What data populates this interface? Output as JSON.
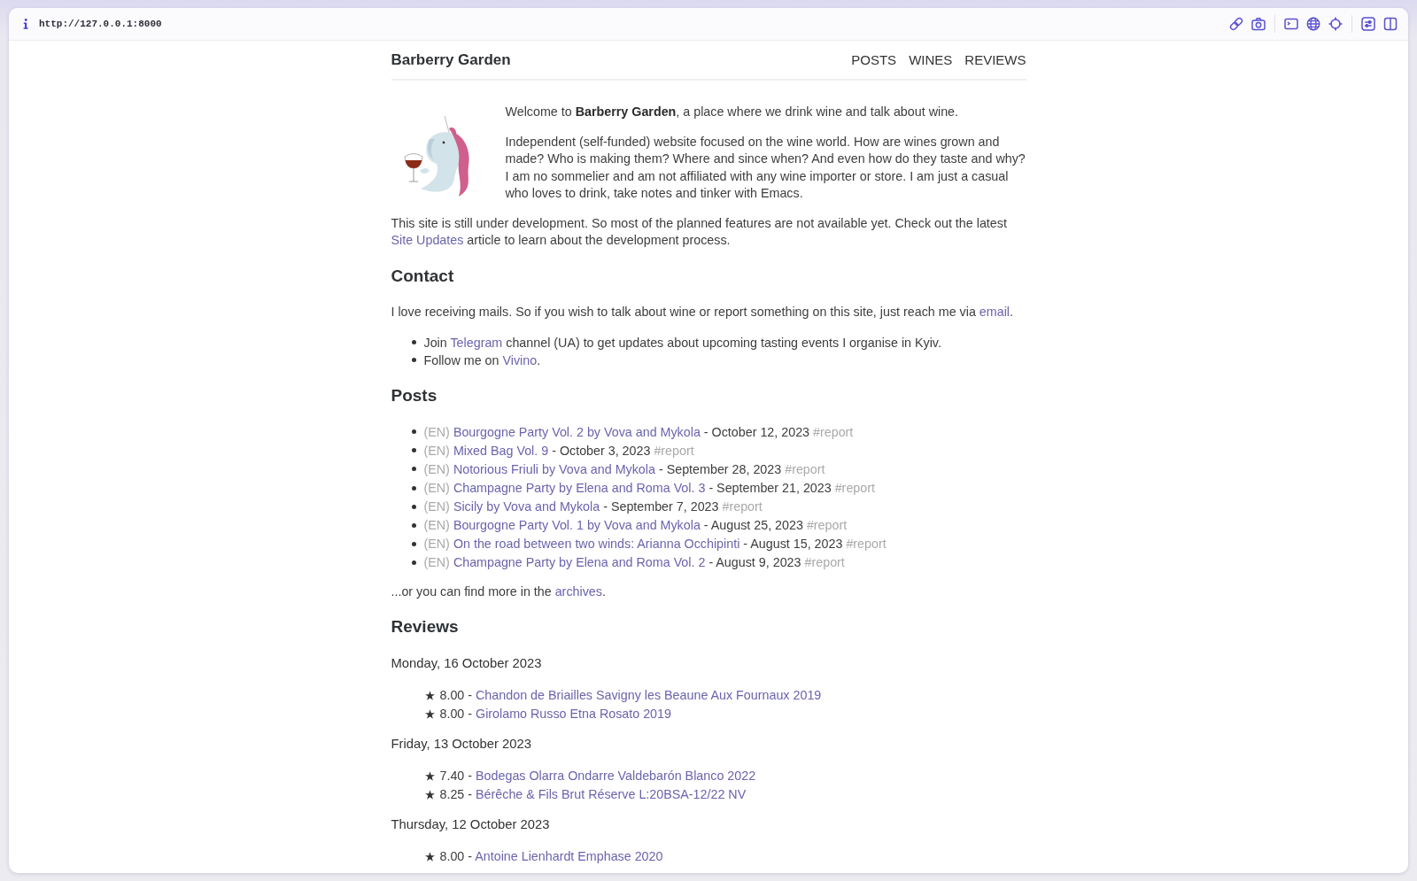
{
  "browser": {
    "url": "http://127.0.0.1:8000"
  },
  "site": {
    "title": "Barberry Garden",
    "nav": [
      {
        "label": "POSTS"
      },
      {
        "label": "WINES"
      },
      {
        "label": "REVIEWS"
      }
    ]
  },
  "intro": {
    "welcome": "Welcome to **Barberry Garden**, a place where we drink wine and talk about wine.",
    "about": "Independent (self-funded) website focused on the wine world. How are wines grown and made? Who is making them? Where and since when? And even how do they taste and why? I am no sommelier and am not affiliated with any wine importer or store. I am just a casual who loves to drink, take notes and tinker with Emacs.",
    "notice": {
      "before": "This site is still under development. So most of the planned features are not available yet. Check out the latest ",
      "link": "Site Updates",
      "after": " article to learn about the development process."
    }
  },
  "contact": {
    "heading": "Contact",
    "text": {
      "before": "I love receiving mails. So if you wish to talk about wine or report something on this site, just reach me via ",
      "link": "email",
      "after": "."
    },
    "items": [
      {
        "before": "Join ",
        "link": "Telegram",
        "after": " channel (UA) to get updates about upcoming tasting events I organise in Kyiv."
      },
      {
        "before": "Follow me on ",
        "link": "Vivino",
        "after": "."
      }
    ]
  },
  "posts": {
    "heading": "Posts",
    "items": [
      {
        "lang": "(EN)",
        "title": "Bourgogne Party Vol. 2 by Vova and Mykola",
        "date": "- October 12, 2023",
        "tag": "#report"
      },
      {
        "lang": "(EN)",
        "title": "Mixed Bag Vol. 9",
        "date": "- October 3, 2023",
        "tag": "#report"
      },
      {
        "lang": "(EN)",
        "title": "Notorious Friuli by Vova and Mykola",
        "date": "- September 28, 2023",
        "tag": "#report"
      },
      {
        "lang": "(EN)",
        "title": "Champagne Party by Elena and Roma Vol. 3",
        "date": "- September 21, 2023",
        "tag": "#report"
      },
      {
        "lang": "(EN)",
        "title": "Sicily by Vova and Mykola",
        "date": "- September 7, 2023",
        "tag": "#report"
      },
      {
        "lang": "(EN)",
        "title": "Bourgogne Party Vol. 1 by Vova and Mykola",
        "date": "- August 25, 2023",
        "tag": "#report"
      },
      {
        "lang": "(EN)",
        "title": "On the road between two winds: Arianna Occhipinti",
        "date": "- August 15, 2023",
        "tag": "#report"
      },
      {
        "lang": "(EN)",
        "title": "Champagne Party by Elena and Roma Vol. 2",
        "date": "- August 9, 2023",
        "tag": "#report"
      }
    ],
    "more": {
      "before": "...or you can find more in the ",
      "link": "archives",
      "after": "."
    }
  },
  "reviews": {
    "heading": "Reviews",
    "days": [
      {
        "date": "Monday, 16 October 2023",
        "items": [
          {
            "score": "8.00 -",
            "wine": "Chandon de Briailles Savigny les Beaune Aux Fournaux 2019"
          },
          {
            "score": "8.00 -",
            "wine": "Girolamo Russo Etna Rosato 2019"
          }
        ]
      },
      {
        "date": "Friday, 13 October 2023",
        "items": [
          {
            "score": "7.40 -",
            "wine": "Bodegas Olarra Ondarre Valdebarón Blanco 2022"
          },
          {
            "score": "8.25 -",
            "wine": "Bérêche & Fils Brut Réserve L:20BSA-12/22 NV"
          }
        ]
      },
      {
        "date": "Thursday, 12 October 2023",
        "items": [
          {
            "score": "8.00 -",
            "wine": "Antoine Lienhardt Emphase 2020"
          }
        ]
      }
    ]
  }
}
